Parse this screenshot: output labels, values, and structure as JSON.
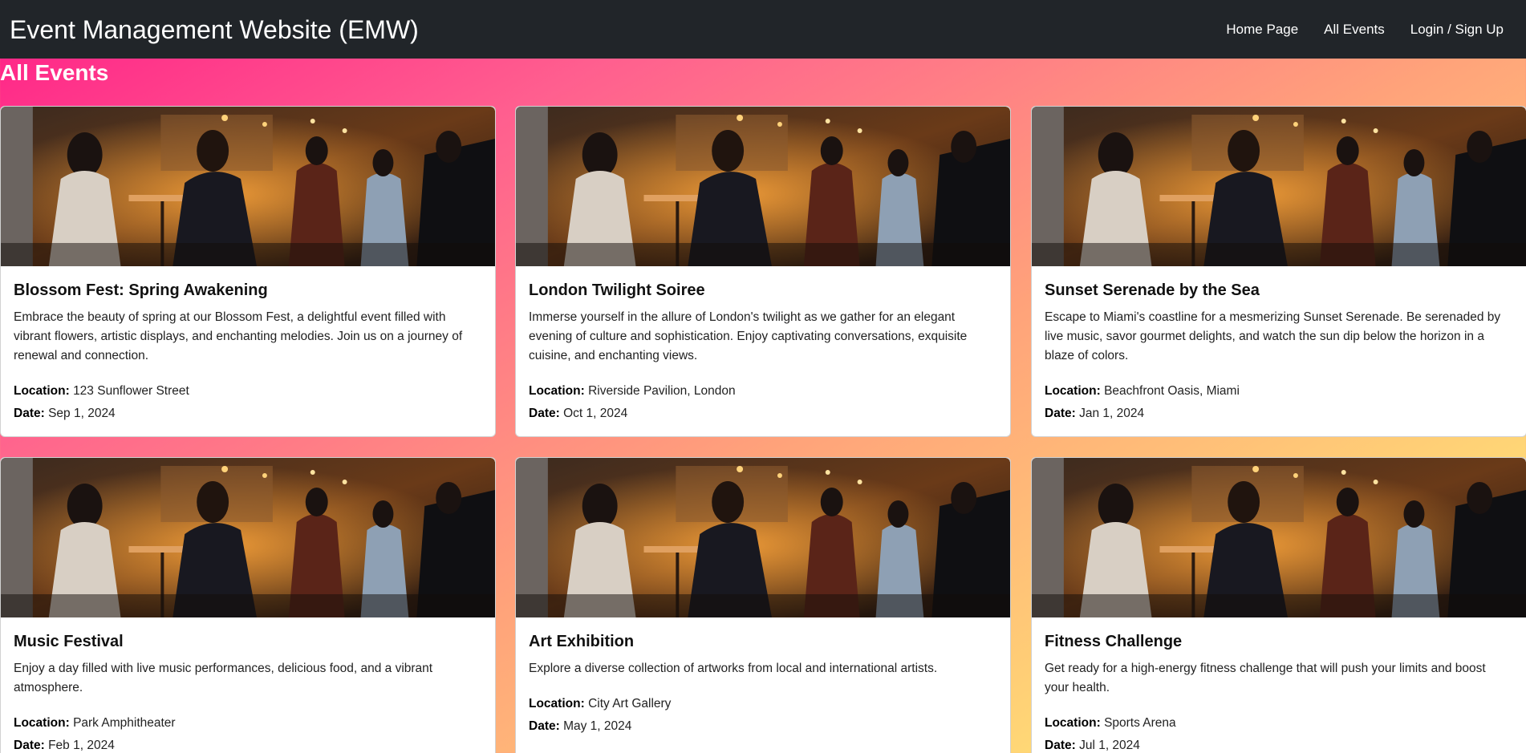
{
  "navbar": {
    "brand": "Event Management Website (EMW)",
    "links": [
      "Home Page",
      "All Events",
      "Login / Sign Up"
    ]
  },
  "page": {
    "title": "All Events"
  },
  "labels": {
    "location": "Location:",
    "date": "Date:"
  },
  "events": [
    {
      "title": "Blossom Fest: Spring Awakening",
      "description": "Embrace the beauty of spring at our Blossom Fest, a delightful event filled with vibrant flowers, artistic displays, and enchanting melodies. Join us on a journey of renewal and connection.",
      "location": "123 Sunflower Street",
      "date": "Sep 1, 2024"
    },
    {
      "title": "London Twilight Soiree",
      "description": "Immerse yourself in the allure of London's twilight as we gather for an elegant evening of culture and sophistication. Enjoy captivating conversations, exquisite cuisine, and enchanting views.",
      "location": "Riverside Pavilion, London",
      "date": "Oct 1, 2024"
    },
    {
      "title": "Sunset Serenade by the Sea",
      "description": "Escape to Miami's coastline for a mesmerizing Sunset Serenade. Be serenaded by live music, savor gourmet delights, and watch the sun dip below the horizon in a blaze of colors.",
      "location": "Beachfront Oasis, Miami",
      "date": "Jan 1, 2024"
    },
    {
      "title": "Music Festival",
      "description": "Enjoy a day filled with live music performances, delicious food, and a vibrant atmosphere.",
      "location": "Park Amphitheater",
      "date": "Feb 1, 2024"
    },
    {
      "title": "Art Exhibition",
      "description": "Explore a diverse collection of artworks from local and international artists.",
      "location": "City Art Gallery",
      "date": "May 1, 2024"
    },
    {
      "title": "Fitness Challenge",
      "description": "Get ready for a high-energy fitness challenge that will push your limits and boost your health.",
      "location": "Sports Arena",
      "date": "Jul 1, 2024"
    }
  ]
}
